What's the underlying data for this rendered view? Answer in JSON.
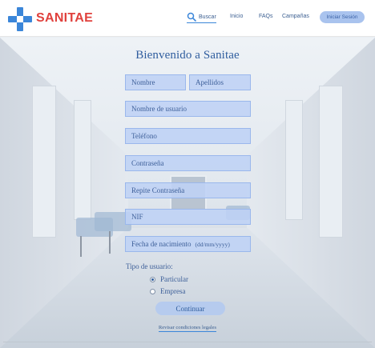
{
  "brand": {
    "name": "SANITAE",
    "cross_color": "#3b86d9",
    "text_color": "#e0413d"
  },
  "nav": {
    "search_label": "Buscar",
    "home_label": "Inicio",
    "faq_label": "FAQs",
    "campaigns_label": "Campañas",
    "login_label": "Iniciar Sesión"
  },
  "form": {
    "title": "Bienvenido a Sanitae",
    "fields": {
      "nombre": "Nombre",
      "apellidos": "Apellidos",
      "usuario": "Nombre de usuario",
      "telefono": "Teléfono",
      "contrasena": "Contraseña",
      "repite": "Repite Contraseña",
      "nif": "NIF",
      "nacimiento": "Fecha de nacimiento",
      "nacimiento_hint": "(dd/mm/yyyy)"
    },
    "user_type": {
      "label": "Tipo de usuario:",
      "options": [
        "Particular",
        "Empresa"
      ],
      "selected": "Particular"
    },
    "continue_label": "Continuar",
    "legal_link": "Revisar condiciones legales"
  },
  "colors": {
    "accent": "#3b86d9",
    "field_bg": "#bed2f5",
    "text": "#3d5f99"
  },
  "icons": [
    "search-icon",
    "sanitae-cross-icon"
  ]
}
